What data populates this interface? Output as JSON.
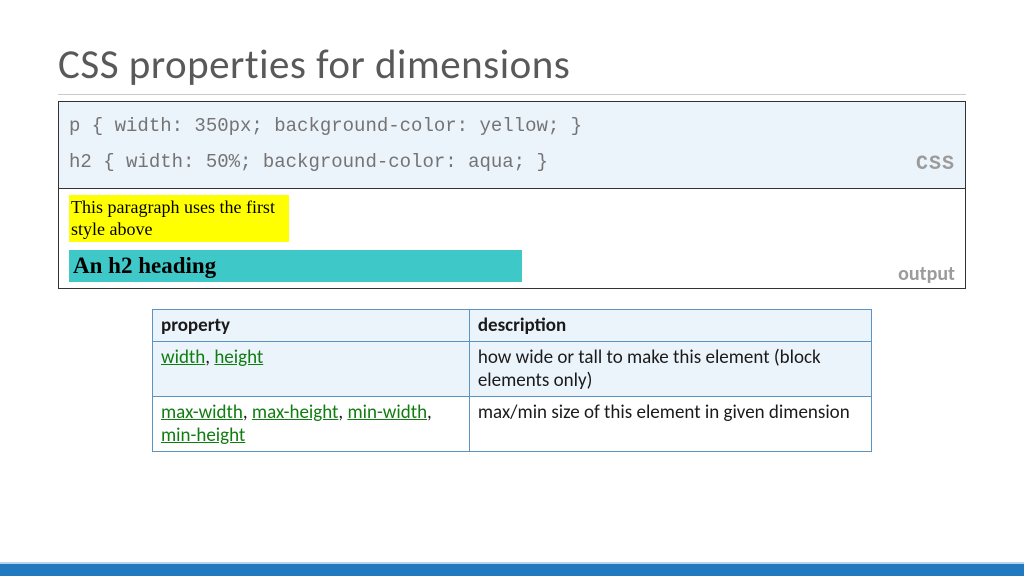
{
  "title": "CSS properties for dimensions",
  "code": {
    "line1": "p { width: 350px; background-color: yellow; }",
    "line2": "h2 { width: 50%; background-color: aqua; }",
    "label": "CSS"
  },
  "output": {
    "paragraph": "This paragraph uses the first style above",
    "heading": "An h2 heading",
    "label": "output"
  },
  "table": {
    "headers": {
      "col1": "property",
      "col2": "description"
    },
    "rows": [
      {
        "props": [
          {
            "text": "width"
          },
          {
            "sep": ", "
          },
          {
            "text": "height"
          }
        ],
        "desc": "how wide or tall to make this element (block elements only)"
      },
      {
        "props": [
          {
            "text": "max-width"
          },
          {
            "sep": ", "
          },
          {
            "text": "max-height"
          },
          {
            "sep": ", "
          },
          {
            "text": "min-width"
          },
          {
            "sep": ", "
          },
          {
            "text": "min-height"
          }
        ],
        "desc": "max/min size of this element in given dimension"
      }
    ]
  }
}
